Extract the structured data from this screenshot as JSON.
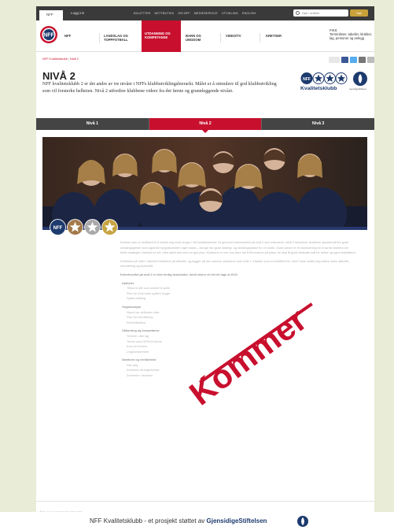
{
  "topbar": {
    "home_tab": "NFF",
    "login": "Logg inn",
    "links": [
      "BILLETTER",
      "NETTBUTIKK",
      "OM NFF",
      "MEDIESERVICE",
      "UTVIKLING",
      "ENGLISH"
    ],
    "search_placeholder": "Søk i artikler",
    "search_button": "Søk"
  },
  "nav": {
    "items": [
      {
        "label": "NFF"
      },
      {
        "label": "LANDSLAG OG TOPPFOTBALL"
      },
      {
        "label": "UTDANNING OG KOMPETANSE",
        "active": true
      },
      {
        "label": "BARN OG UNGDOM"
      },
      {
        "label": "VIDEO/TV"
      },
      {
        "label": "KRETSER"
      }
    ],
    "fiks_title": "FIKS:",
    "fiks_text": "Terminlister, tabeller, klubber, lag, personer og anlegg"
  },
  "breadcrumb": [
    "NFF Kvalitetsklubb",
    "Nivå 2"
  ],
  "page": {
    "title": "NIVÅ 2",
    "intro": "NFF kvalitetsklubb 2 er det andre av tre nivåer i NFFs klubbutviklingshierarki. Målet er å stimulere til god klubbutvikling som vil forsterke helheten. Nivå 2 utfordrer klubbene videre fra det første og grunnleggende nivået.",
    "kk_label": "Kvalitetsklubb",
    "sponsor_text": "GjensidigeStiftelsen"
  },
  "levels": [
    {
      "label": "Nivå 1",
      "active": false
    },
    {
      "label": "Nivå 2",
      "active": true
    },
    {
      "label": "Nivå 3",
      "active": false
    }
  ],
  "content": {
    "p1": "Klubber som er sertifisert til å utvikle seg enda lenger i sitt kvalitetsarbeid. Et generelt kriteriearbeid på nivå 2 som inkluderer. Nivå 2 stimulerer klubbene spesielt på fire gode utviklingsgrener som også blir tyngdepunktet i egen skala – ikonge har gode strategi- og utviklingsplaner for en klubb. Gode planer er en forutsetning for å samle klubben om felles strategier. Aktivitet er det. Med aktivt kan med en god plan. Klubbene er mer enn bare det å få trenerne på plass, de skal få gode fastsatte mål for aktive og egne klubbtilbud.",
    "p2": "Kriteriene på nivå 2 utfordrer klubbene på aktivitet, og bygger på den samme strukturen som nivå 1. Klubber som er kvalifisert for nivå 2 skal utvikle seg videre innen aktivitet, rekruttering og klubbdrift.",
    "criteria_heading": "Kriteriesettet på nivå 2 er ikke ferdig bearbeidet. Inntil videre vil det bli lagt ut 2015.",
    "sections": [
      {
        "title": "Aktivitet",
        "items": [
          "Tilbud til alle som ønsker å spille",
          "Plan for å beholde spillere lenger",
          "Spillerutvikling"
        ]
      },
      {
        "title": "Organisasjon",
        "items": [
          "Styret har definerte roller",
          "Plan for rekruttering",
          "Klubbhåndbok"
        ]
      },
      {
        "title": "Utdanning og kompetanse",
        "items": [
          "Trenere i alle lag",
          "Trener med UEFA B-lisens",
          "Kurs for trenere",
          "Ungdomstrenere"
        ]
      },
      {
        "title": "Samfunn og verdiarbeid",
        "items": [
          "Fair play",
          "Klubbens arrangementer",
          "Dommere i klubben"
        ]
      }
    ]
  },
  "stamp": "Kommer",
  "partners_label": "VÅRE SAMARBEIDSPARTNERE",
  "footer": {
    "text_part1": "NFF Kvalitetsklubb - et prosjekt støttet av",
    "text_part2": "GjensidigeStiftelsen"
  },
  "colors": {
    "accent": "#c8102e",
    "navy": "#1d3b6e",
    "tab_bg": "#444444",
    "background": "#e9ecd6"
  },
  "icons": [
    "search-icon",
    "nff-logo",
    "kvalitetsklubb-stars-icon",
    "gjensidige-logo-icon",
    "share-icons",
    "star-badge-icon"
  ]
}
